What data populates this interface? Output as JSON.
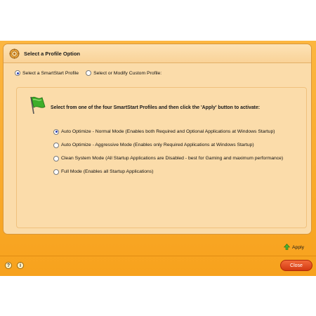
{
  "panel": {
    "title": "Select a Profile Option"
  },
  "profile_choice": {
    "smartstart_label": "Select a SmartStart Profile",
    "custom_label": "Select or Modify Custom Profile:",
    "selected": "smartstart"
  },
  "instruction": "Select from one of the four SmartStart Profiles and then click the 'Apply' button to activate:",
  "options": [
    {
      "label": "Auto Optimize - Normal Mode (Enables both Required and Optional Applications at Windows Startup)",
      "selected": true
    },
    {
      "label": "Auto Optimize - Aggressive Mode (Enables only Required Applications at Windows Startup)",
      "selected": false
    },
    {
      "label": "Clean System Mode (All Startup Applications are Disabled - best for Gaming and maximum performance)",
      "selected": false
    },
    {
      "label": "Full Mode (Enables all Startup Applications)",
      "selected": false
    }
  ],
  "buttons": {
    "apply": "Apply",
    "close": "Close"
  },
  "icons": {
    "header": "gear-icon",
    "instruction": "flag-icon",
    "apply": "arrow-up-icon",
    "help": "help-icon",
    "info": "info-icon"
  },
  "colors": {
    "window_orange": "#f7a21d",
    "panel_bg": "#fbdcaa",
    "close_red": "#e04a1e",
    "radio_dot": "#2b3fb0"
  }
}
